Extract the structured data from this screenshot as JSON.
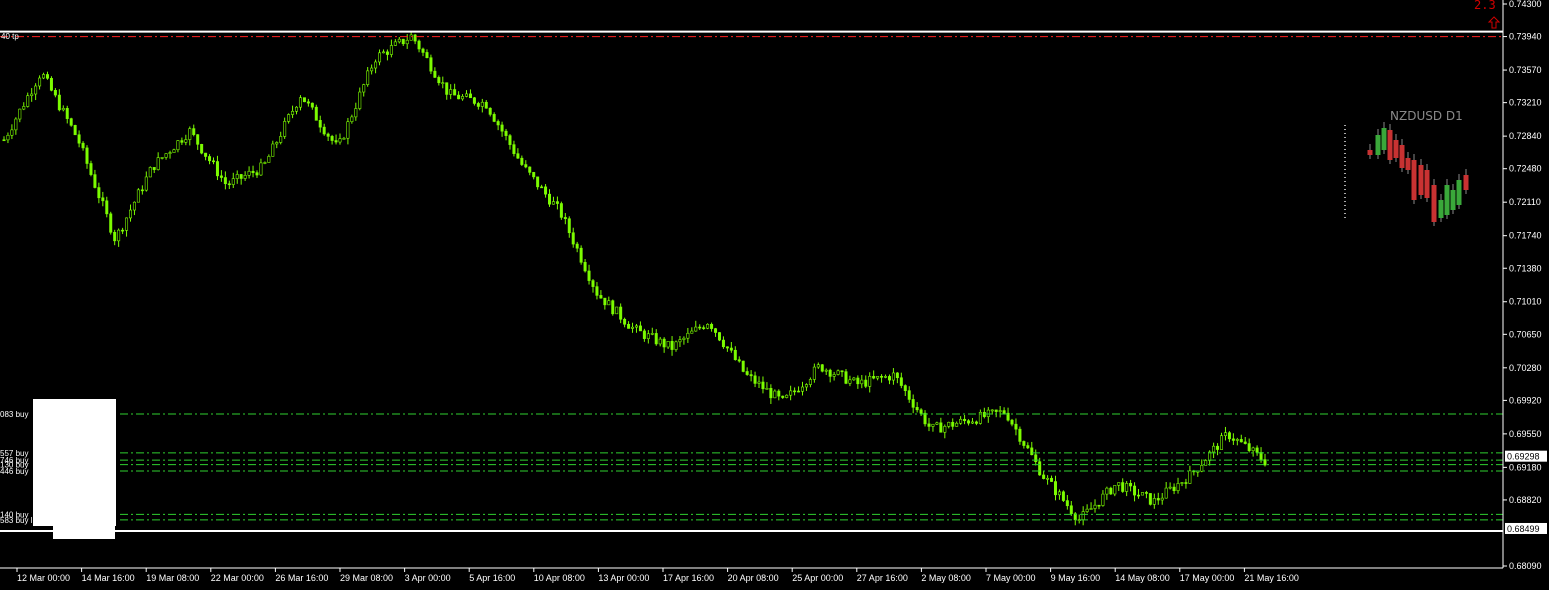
{
  "chart": {
    "symbol_label": "NZDUSD D1",
    "spread_label": "2.3",
    "colors": {
      "background": "#000000",
      "bull": "#7CFC00",
      "bear": "#7CFC00",
      "tp_line": "#ff2020",
      "order_line": "#2fcf2f",
      "axis_text": "#ffffff",
      "mini_bull": "#3aa83a",
      "mini_bear": "#c83232"
    },
    "price_axis": {
      "ticks": [
        "0.74300",
        "0.73940",
        "0.73570",
        "0.73210",
        "0.72840",
        "0.72480",
        "0.72110",
        "0.71740",
        "0.71380",
        "0.71010",
        "0.70650",
        "0.70280",
        "0.69920",
        "0.69550",
        "0.69180",
        "0.68820",
        "0.68090"
      ],
      "current_bid": "0.69298",
      "current_ask": "0.68499",
      "ylim": [
        0.6809,
        0.743
      ]
    },
    "time_axis": {
      "ticks": [
        "12 Mar 00:00",
        "14 Mar 16:00",
        "19 Mar 08:00",
        "22 Mar 00:00",
        "26 Mar 16:00",
        "29 Mar 08:00",
        "3 Apr 00:00",
        "5 Apr 16:00",
        "10 Apr 08:00",
        "13 Apr 00:00",
        "17 Apr 16:00",
        "20 Apr 08:00",
        "25 Apr 00:00",
        "27 Apr 16:00",
        "2 May 08:00",
        "7 May 00:00",
        "9 May 16:00",
        "14 May 08:00",
        "17 May 00:00",
        "21 May 16:00"
      ]
    },
    "tp_label": "40 tp",
    "tp_price": 0.7394,
    "orders": [
      {
        "label": "083 buy",
        "price": 0.6977
      },
      {
        "label": "557 buy",
        "price": 0.6934
      },
      {
        "label": "746 buy",
        "price": 0.6926
      },
      {
        "label": "130 buy",
        "price": 0.6921
      },
      {
        "label": "446 buy",
        "price": 0.6914
      },
      {
        "label": "140 buy",
        "price": 0.6866
      },
      {
        "label": "583 buy limit",
        "price": 0.686
      }
    ]
  },
  "chart_data": {
    "type": "line",
    "title": "NZDUSD D1",
    "x": [
      "12 Mar 00:00",
      "14 Mar 16:00",
      "19 Mar 08:00",
      "22 Mar 00:00",
      "26 Mar 16:00",
      "29 Mar 08:00",
      "3 Apr 00:00",
      "5 Apr 16:00",
      "10 Apr 08:00",
      "13 Apr 00:00",
      "17 Apr 16:00",
      "20 Apr 08:00",
      "25 Apr 00:00",
      "27 Apr 16:00",
      "2 May 08:00",
      "7 May 00:00",
      "9 May 16:00",
      "14 May 08:00",
      "17 May 00:00",
      "21 May 16:00"
    ],
    "series": [
      {
        "values": [
          0.728,
          0.7355,
          0.728,
          0.717,
          0.725,
          0.729,
          0.723,
          0.725,
          0.733,
          0.727,
          0.737,
          0.7395,
          0.733,
          0.732,
          0.725,
          0.72,
          0.711,
          0.707,
          0.705,
          0.708,
          0.702,
          0.699,
          0.703,
          0.701,
          0.702,
          0.696,
          0.697,
          0.698,
          0.691,
          0.686,
          0.69,
          0.688,
          0.691,
          0.6955,
          0.6925
        ]
      }
    ],
    "ylim": [
      0.6809,
      0.743
    ]
  }
}
